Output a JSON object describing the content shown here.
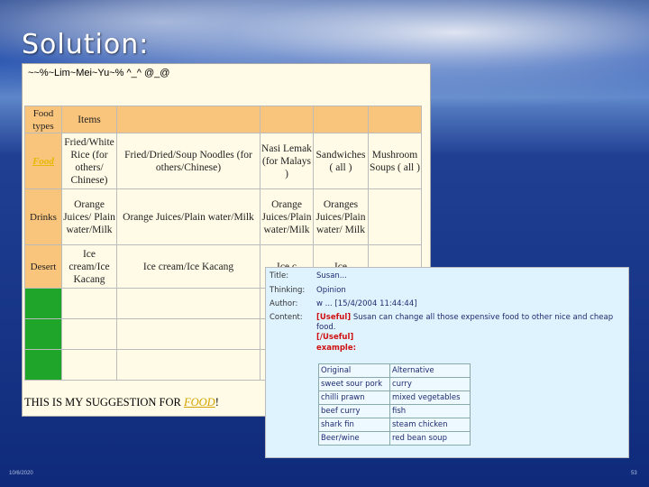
{
  "slide": {
    "title": "Solution:",
    "footer_date": "10/6/2020",
    "page_number": "53"
  },
  "panel1": {
    "header": "~~%~Lim~Mei~Yu~% ^_^ @_@",
    "col_headers": [
      "Food types",
      "Items",
      "",
      "",
      "",
      ""
    ],
    "rows": [
      {
        "type": "Food",
        "cells": [
          "Fried/White Rice (for others/ Chinese)",
          "Fried/Dried/Soup Noodles (for others/Chinese)",
          "Nasi Lemak (for Malays )",
          "Sandwiches ( all )",
          "Mushroom Soups ( all )"
        ]
      },
      {
        "type": "Drinks",
        "cells": [
          "Orange Juices/ Plain water/Milk",
          "Orange Juices/Plain water/Milk",
          "Orange Juices/Plain water/Milk",
          "Oranges Juices/Plain water/ Milk",
          ""
        ]
      },
      {
        "type": "Desert",
        "cells": [
          "Ice cream/Ice Kacang",
          "Ice cream/Ice Kacang",
          "Ice c",
          "Ice",
          ""
        ]
      }
    ],
    "suggestion_prefix": "THIS IS MY SUGGESTION FOR ",
    "suggestion_word": "FOOD",
    "suggestion_suffix": "!"
  },
  "panel2": {
    "title_label": "Title:",
    "title_value": "Susan...",
    "thinking_label": "Thinking:",
    "thinking_value": "Opinion",
    "author_label": "Author:",
    "author_value": "w ... [15/4/2004 11:44:44]",
    "content_label": "Content:",
    "useful_open": "[Useful]",
    "content_text": "Susan can change all those expensive food to other nice and cheap food.",
    "useful_close": "[/Useful]",
    "example_label": "example:",
    "example_rows": [
      [
        "Original",
        "Alternative"
      ],
      [
        "sweet sour pork",
        "curry"
      ],
      [
        "chilli prawn",
        "mixed vegetables"
      ],
      [
        "beef curry",
        "fish"
      ],
      [
        "shark fin",
        "steam chicken"
      ],
      [
        "Beer/wine",
        "red bean soup"
      ]
    ]
  }
}
